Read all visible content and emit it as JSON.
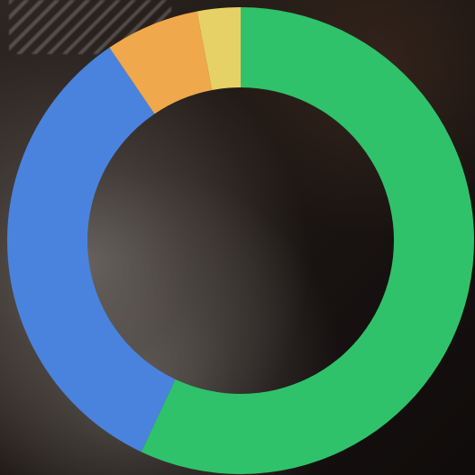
{
  "chart_data": {
    "type": "pie",
    "variant": "donut",
    "title": "",
    "series": [
      {
        "values": [
          57.0,
          33.5,
          6.5,
          3.0
        ],
        "colors": [
          "#2fc26a",
          "#4a83dd",
          "#f0a84c",
          "#e6d166"
        ]
      }
    ],
    "start": "top",
    "direction": "clockwise",
    "legend": "none",
    "grid": false
  }
}
